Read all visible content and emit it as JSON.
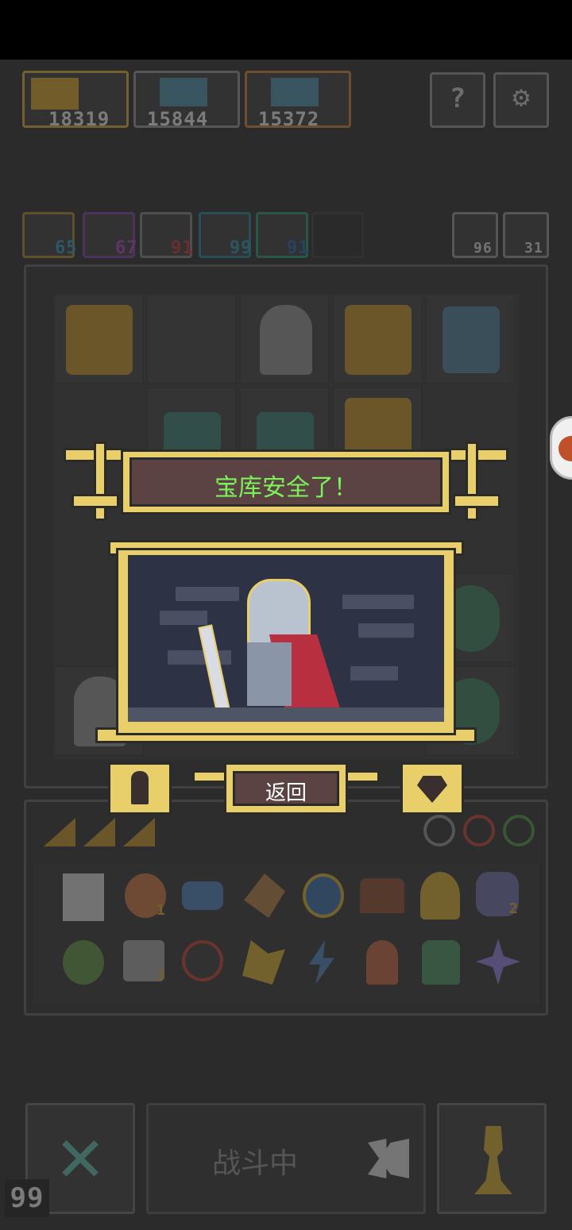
{
  "top_heroes": [
    {
      "score": "18319",
      "color": "#c8a030"
    },
    {
      "score": "15844",
      "color": "#8a8a8a"
    },
    {
      "score": "15372",
      "color": "#c07838"
    }
  ],
  "top_buttons": {
    "help_icon": "question-icon",
    "settings_icon": "gear-icon"
  },
  "stats": [
    {
      "value": "65",
      "color": "#2e8fb0",
      "border": "#a07c2c"
    },
    {
      "value": "67",
      "color": "#a040b0",
      "border": "#7c3aa0"
    },
    {
      "value": "91",
      "color": "#c03030",
      "border": "#7c7c7c"
    },
    {
      "value": "99",
      "color": "#2a8aa0",
      "border": "#2a7a8a"
    },
    {
      "value": "91",
      "color": "#2060a0",
      "border": "#2a8a6a"
    }
  ],
  "right_counters": [
    {
      "value": "96",
      "icon": "return-arrow-icon"
    },
    {
      "value": "31",
      "icon": "pawn-icon"
    }
  ],
  "modal": {
    "title": "宝库安全了！",
    "back_label": "返回"
  },
  "footer": {
    "status_label": "战斗中",
    "counter": "99"
  },
  "inventory": {
    "row1_badges": [
      "",
      "1",
      "",
      "",
      "",
      "",
      "",
      "2"
    ],
    "row2_badges": [
      "",
      "3",
      "",
      "",
      "",
      "",
      "",
      "5"
    ]
  }
}
